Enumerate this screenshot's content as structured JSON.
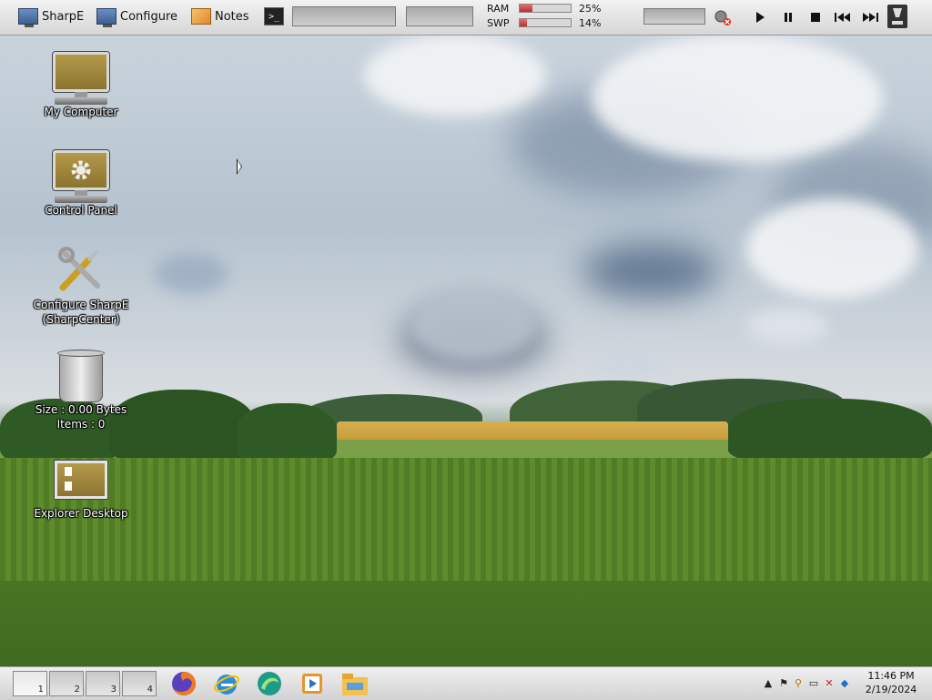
{
  "top_panel": {
    "sharpe_label": "SharpE",
    "configure_label": "Configure",
    "notes_label": "Notes",
    "terminal_glyph": ">_",
    "ram_label": "RAM",
    "ram_percent": "25%",
    "ram_fraction": 0.25,
    "swp_label": "SWP",
    "swp_percent": "14%",
    "swp_fraction": 0.14
  },
  "desktop": {
    "icons": [
      {
        "label": "My Computer"
      },
      {
        "label": "Control Panel"
      },
      {
        "label_line1": "Configure SharpE",
        "label_line2": "(SharpCenter)"
      },
      {
        "label_line1": "Size : 0.00 Bytes",
        "label_line2": "Items : 0"
      },
      {
        "label": "Explorer Desktop"
      }
    ]
  },
  "taskbar": {
    "workspaces": [
      "1",
      "2",
      "3",
      "4"
    ],
    "launchers": [
      "firefox-icon",
      "internet-explorer-icon",
      "browser-icon",
      "media-player-icon",
      "file-explorer-icon"
    ],
    "clock_time": "11:46 PM",
    "clock_date": "2/19/2024"
  }
}
